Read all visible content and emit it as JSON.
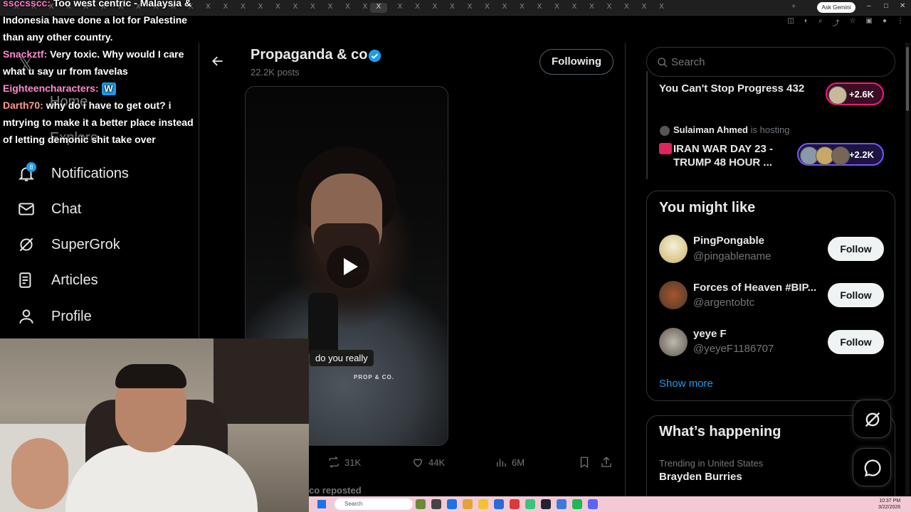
{
  "browser": {
    "ask_gemini": "Ask Gemini",
    "tab_glyph": "X",
    "active_tab_glyph": "X",
    "new_tab": "+"
  },
  "chat_overlay": [
    {
      "user": "ssccsscc:",
      "text": "Too west centric - Malaysia & Indonesia have done a lot for Palestine than any other country."
    },
    {
      "user": "Snackztf:",
      "text": "Very toxic. Why would I care what u say ur from favelas"
    },
    {
      "user": "Eighteencharacters:",
      "text": ""
    },
    {
      "user": "Darth70:",
      "text": "why do i have to get out? i mtrying to make it a better place instead of letting demonic shit take over"
    }
  ],
  "nav": {
    "home": "Home",
    "explore": "Explore",
    "notifications": "Notifications",
    "notifications_badge": "8",
    "chat": "Chat",
    "supergrok": "SuperGrok",
    "articles": "Articles",
    "profile": "Profile"
  },
  "profile_header": {
    "name": "Propaganda & co",
    "posts": "22.2K posts",
    "following_label": "Following"
  },
  "video": {
    "caption": "do you really",
    "brand": "PROP & CO."
  },
  "post_actions": {
    "reposts": "31K",
    "likes": "44K",
    "views": "6M"
  },
  "repost_line": "co reposted",
  "search": {
    "placeholder": "Search"
  },
  "spaces": [
    {
      "title": "You Can't Stop Progress 432",
      "count": "+2.6K",
      "accent": "#f91880"
    },
    {
      "host": "Sulaiman Ahmed",
      "host_suffix": "is hosting",
      "title": "IRAN WAR DAY 23 - TRUMP 48 HOUR ...",
      "count": "+2.2K",
      "accent": "#7856ff"
    }
  ],
  "who_to_follow": {
    "title": "You might like",
    "items": [
      {
        "name": "PingPongable",
        "handle": "@pingablename",
        "button": "Follow"
      },
      {
        "name": "Forces of Heaven #BIP...",
        "handle": "@argentobtc",
        "button": "Follow"
      },
      {
        "name": "yeye F",
        "handle": "@yeyeF1186707",
        "button": "Follow"
      }
    ],
    "show_more": "Show more"
  },
  "whats_happening": {
    "title": "What’s happening",
    "trend_meta": "Trending in United States",
    "trend_name": "Brayden Burries"
  },
  "taskbar": {
    "search": "Search",
    "time": "10:37 PM",
    "date": "3/22/2026"
  },
  "colors": {
    "accent_blue": "#1d9bf0",
    "background": "#000000",
    "border": "#2f3336",
    "taskbar": "#f4c9d6"
  }
}
